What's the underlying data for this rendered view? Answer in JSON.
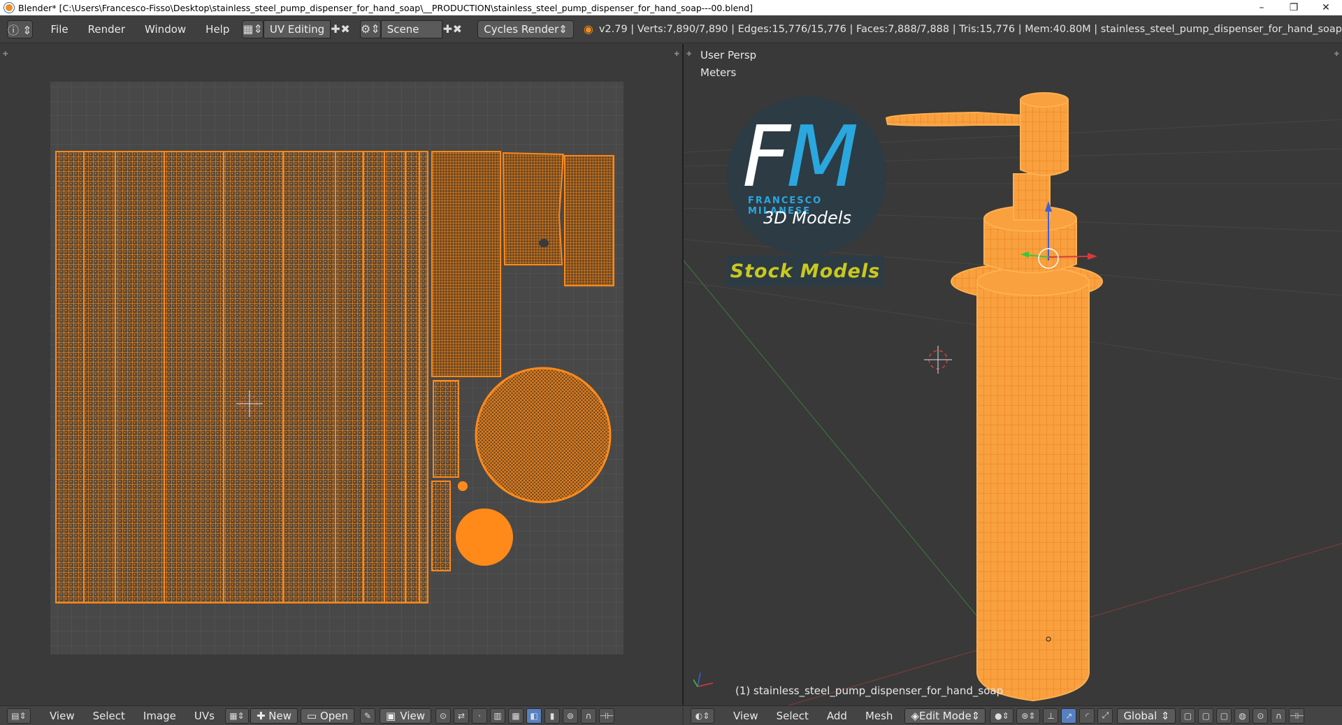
{
  "window": {
    "title": "Blender* [C:\\Users\\Francesco-Fisso\\Desktop\\stainless_steel_pump_dispenser_for_hand_soap\\__PRODUCTION\\stainless_steel_pump_dispenser_for_hand_soap---00.blend]",
    "minimize": "–",
    "restore": "❐",
    "close": "✕"
  },
  "topbar": {
    "menus": [
      "File",
      "Render",
      "Window",
      "Help"
    ],
    "screen_layout": "UV Editing",
    "scene": "Scene",
    "render_engine": "Cycles Render",
    "stats": "v2.79 | Verts:7,890/7,890 | Edges:15,776/15,776 | Faces:7,888/7,888 | Tris:15,776 | Mem:40.80M | stainless_steel_pump_dispenser_for_hand_soap"
  },
  "viewport": {
    "view_name": "User Persp",
    "units": "Meters",
    "object_label": "(1) stainless_steel_pump_dispenser_for_hand_soap"
  },
  "watermark": {
    "fm_f": "F",
    "fm_m": "M",
    "brand": "FRANCESCO MILANESE",
    "models": "3D Models",
    "stock": "Stock Models"
  },
  "uv_bottom": {
    "menus": [
      "View",
      "Select",
      "Image",
      "UVs"
    ],
    "new_label": "New",
    "open_label": "Open",
    "view_label": "View"
  },
  "vp_bottom": {
    "menus": [
      "View",
      "Select",
      "Add",
      "Mesh"
    ],
    "mode": "Edit Mode",
    "orientation": "Global"
  },
  "colors": {
    "mesh_orange": "#ff8a1a",
    "panel_bg": "#393939",
    "uv_grid": "#555555",
    "accent_blue": "#2aa7df",
    "stock_yellow": "#c9c91e"
  }
}
